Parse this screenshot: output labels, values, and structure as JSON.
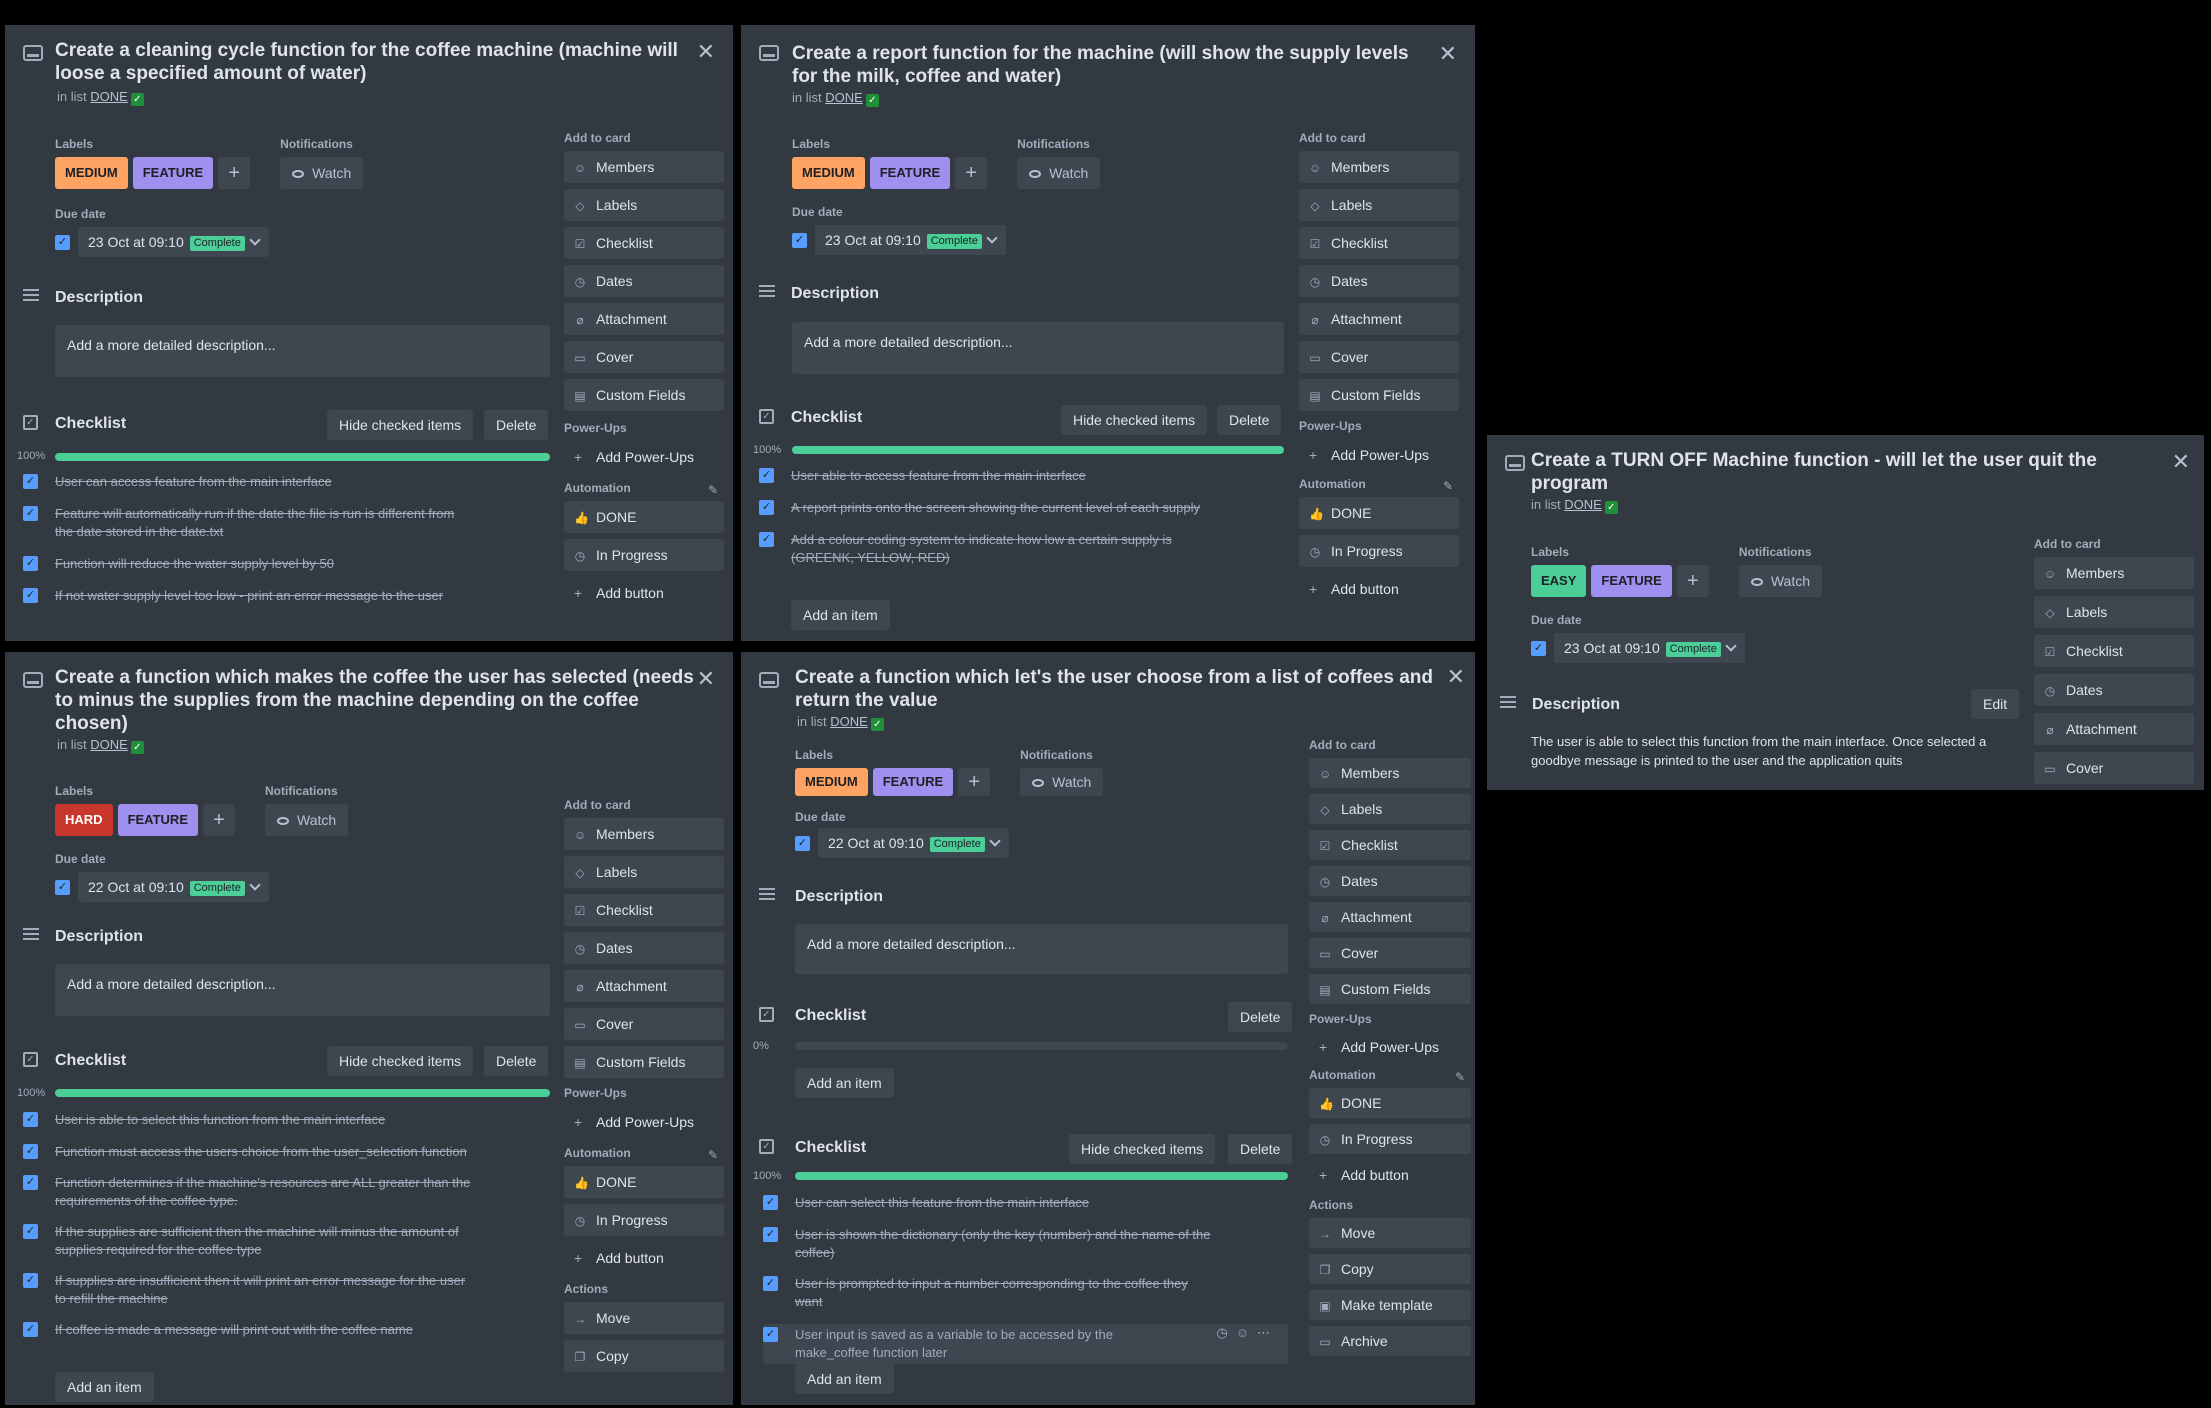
{
  "common": {
    "in_list_prefix": "in list",
    "list_name": "DONE",
    "labels_heading": "Labels",
    "notifications_heading": "Notifications",
    "watch": "Watch",
    "due_heading": "Due date",
    "complete": "Complete",
    "description": "Description",
    "desc_placeholder": "Add a more detailed description...",
    "checklist": "Checklist",
    "hide_checked": "Hide checked items",
    "delete": "Delete",
    "add_item": "Add an item",
    "edit": "Edit",
    "add_to_card": "Add to card",
    "power_ups": "Power-Ups",
    "add_power_ups": "Add Power-Ups",
    "automation": "Automation",
    "done": "DONE",
    "in_progress": "In Progress",
    "add_button": "Add button",
    "actions": "Actions",
    "side_buttons": [
      "Members",
      "Labels",
      "Checklist",
      "Dates",
      "Attachment",
      "Cover",
      "Custom Fields"
    ],
    "move": "Move",
    "copy": "Copy",
    "make_template": "Make template",
    "archive": "Archive"
  },
  "cards": [
    {
      "title": "Create a cleaning cycle function for the coffee machine (machine will loose a specified amount of water)",
      "labels": [
        "MEDIUM",
        "FEATURE"
      ],
      "due": "23 Oct at 09:10",
      "progress": "100%",
      "items": [
        "User can access feature from the main interface",
        "Feature will automatically run if the date the file is run is different from the date stored in the date.txt",
        "Function will reduce the water supply level by 50",
        "If not water supply level too low - print an error message to the user"
      ]
    },
    {
      "title": "Create a report function for the machine (will show the supply levels for the milk, coffee and water)",
      "labels": [
        "MEDIUM",
        "FEATURE"
      ],
      "due": "23 Oct at 09:10",
      "progress": "100%",
      "items": [
        "User able to access feature from the main interface",
        "A report prints onto the screen showing the current level of each supply",
        "Add a colour coding system to indicate how low a certain supply is (GREENK, YELLOW, RED)"
      ]
    },
    {
      "title": "Create a TURN OFF Machine function - will let the user quit the program",
      "labels": [
        "EASY",
        "FEATURE"
      ],
      "due": "23 Oct at 09:10",
      "description": "The user is able to select this function from the main interface. Once selected a goodbye message is printed to the user and the application quits"
    },
    {
      "title": "Create a function which makes the coffee the user has selected (needs to minus the supplies from the machine depending on the coffee chosen)",
      "labels": [
        "HARD",
        "FEATURE"
      ],
      "due": "22 Oct at 09:10",
      "progress": "100%",
      "items": [
        "User is able to select this function from the main interface",
        "Function must access the users choice from the user_selection function",
        "Function determines if the machine's resources are ALL greater than the requirements of the coffee type.",
        "If the supplies are sufficient then the machine will minus the amount of supplies required for the coffee type",
        "If supplies are insufficient then it will print an error message for the user to refill the machine",
        "If coffee is made a message will print out with the coffee name"
      ]
    },
    {
      "title": "Create a function which let's the user choose from a list of coffees and return the value",
      "labels": [
        "MEDIUM",
        "FEATURE"
      ],
      "due": "22 Oct at 09:10",
      "progress_empty": "0%",
      "progress": "100%",
      "items": [
        "User can select this feature from the main interface",
        "User is shown the dictionary (only the key (number) and the name of the coffee)",
        "User is prompted to input a number corresponding to the coffee they want",
        "User input is saved as a variable to be accessed by the make_coffee function later"
      ]
    }
  ],
  "colors": {
    "medium": "#fea362",
    "feature": "#9f8fef",
    "hard": "#c9372c",
    "easy": "#4bce97",
    "progress": "#4bce97"
  }
}
